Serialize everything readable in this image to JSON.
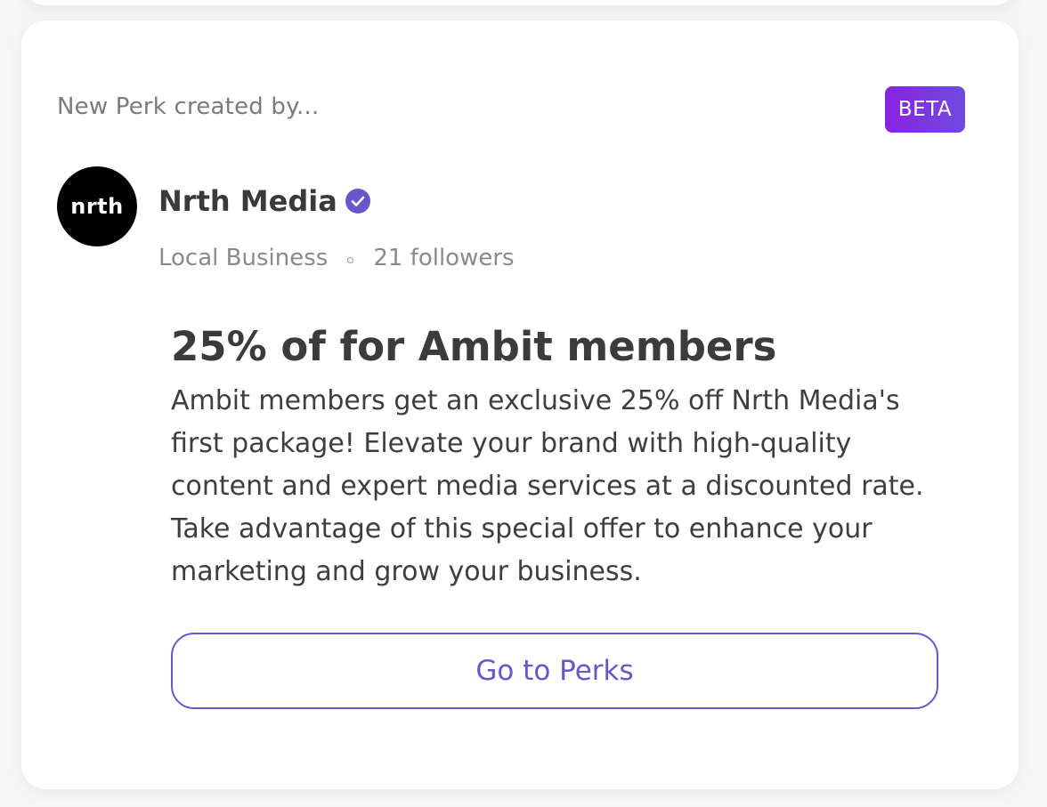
{
  "card": {
    "header_label": "New Perk created by...",
    "badge": "BETA",
    "colors": {
      "badge_gradient_start": "#8a22e0",
      "badge_gradient_end": "#6f4be0",
      "accent": "#6a55c9"
    }
  },
  "business": {
    "avatar_text": "nrth",
    "name": "Nrth Media",
    "verified_icon": "verified-check-icon",
    "category": "Local Business",
    "followers": "21 followers"
  },
  "perk": {
    "title": "25% of for Ambit members",
    "description": "Ambit members get an exclusive 25% off Nrth Media's first package! Elevate your brand with high-quality content and expert media services at a discounted rate. Take advantage of this special offer to enhance your marketing and grow your business.",
    "cta_label": "Go to Perks"
  }
}
